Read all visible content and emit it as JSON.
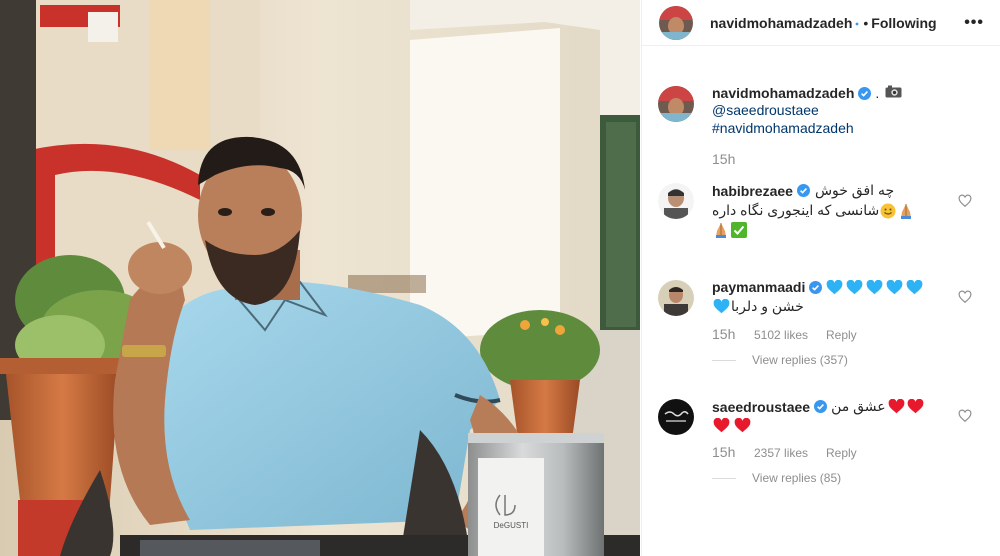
{
  "header": {
    "username": "navidmohamadzadeh",
    "dot": "•",
    "follow_status": "Following",
    "more": "•••"
  },
  "caption": {
    "username": "navidmohamadzadeh",
    "sep": ".",
    "mention": "@saeedroustaee",
    "hashtag": "#navidmohamadzadeh",
    "time": "15h"
  },
  "comments": [
    {
      "username": "habibrezaee",
      "text_line1": "چه افق خوش",
      "text_line2": "شانسی که اینجوری نگاه داره"
    },
    {
      "username": "paymanmaadi",
      "text_line2": "خشن و دلربا",
      "time": "15h",
      "likes": "5102 likes",
      "reply": "Reply",
      "view_replies": "View replies (357)"
    },
    {
      "username": "saeedroustaee",
      "text_line1": "عشق من",
      "time": "15h",
      "likes": "2357 likes",
      "reply": "Reply",
      "view_replies": "View replies (85)"
    }
  ],
  "photo": {
    "product_brand": "DeGUSTI"
  },
  "colors": {
    "verified_blue": "#3897f0",
    "link_blue": "#00376b",
    "muted_gray": "#8e8e8e",
    "heart_red": "#e8192c",
    "heart_blue": "#2db2f5",
    "shirt": "#8fc7df"
  }
}
